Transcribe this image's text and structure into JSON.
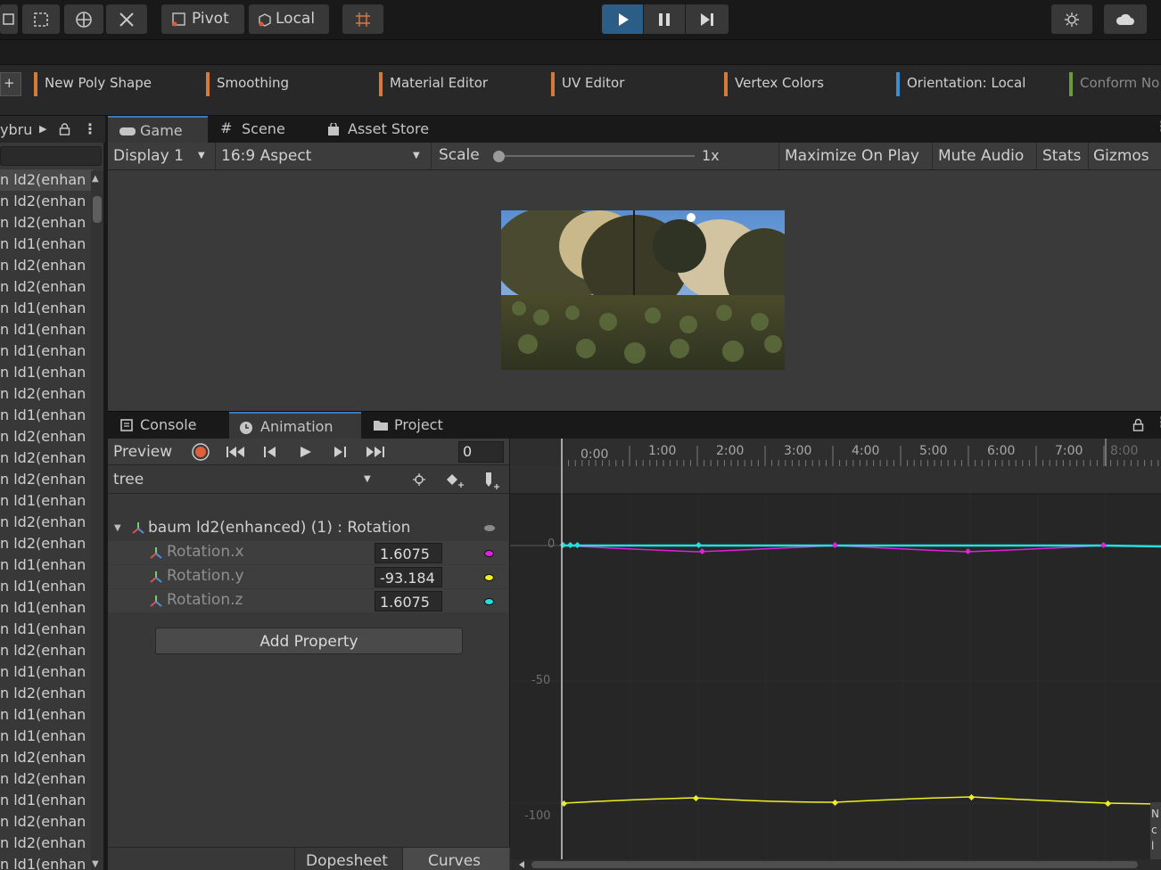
{
  "toolbar": {
    "pivot_label": "Pivot",
    "local_label": "Local"
  },
  "probuilder": {
    "add_label": "+",
    "items": [
      {
        "label": "New Poly Shape",
        "color": "#d47a3a"
      },
      {
        "label": "Smoothing",
        "color": "#d47a3a"
      },
      {
        "label": "Material Editor",
        "color": "#d47a3a"
      },
      {
        "label": "UV Editor",
        "color": "#d47a3a"
      },
      {
        "label": "Vertex Colors",
        "color": "#d47a3a"
      },
      {
        "label": "Orientation: Local",
        "color": "#3b8ed0"
      },
      {
        "label": "Conform No",
        "color": "#6a9a3a"
      }
    ]
  },
  "hierarchy": {
    "title": "ybru",
    "rows": [
      "n ld2(enhan",
      "n ld2(enhan",
      "n ld2(enhan",
      "n ld1(enhan",
      "n ld2(enhan",
      "n ld2(enhan",
      "n ld1(enhan",
      "n ld1(enhan",
      "n ld1(enhan",
      "n ld1(enhan",
      "n ld2(enhan",
      "n ld1(enhan",
      "n ld2(enhan",
      "n ld2(enhan",
      "n ld2(enhan",
      "n ld1(enhan",
      "n ld2(enhan",
      "n ld2(enhan",
      "n ld1(enhan",
      "n ld1(enhan",
      "n ld1(enhan",
      "n ld1(enhan",
      "n ld2(enhan",
      "n ld1(enhan",
      "n ld2(enhan",
      "n ld1(enhan",
      "n ld1(enhan",
      "n ld2(enhan",
      "n ld2(enhan",
      "n ld1(enhan",
      "n ld2(enhan",
      "n ld2(enhan",
      "n ld1(enhan"
    ]
  },
  "game": {
    "tabs": [
      "Game",
      "Scene",
      "Asset Store"
    ],
    "display": "Display 1",
    "aspect": "16:9 Aspect",
    "scale_label": "Scale",
    "scale_value": "1x",
    "maximize": "Maximize On Play",
    "mute": "Mute Audio",
    "stats": "Stats",
    "gizmos": "Gizmos"
  },
  "animation": {
    "tabs": [
      "Console",
      "Animation",
      "Project"
    ],
    "preview": "Preview",
    "frame": "0",
    "clip": "tree",
    "group": "baum ld2(enhanced) (1) : Rotation",
    "properties": [
      {
        "name": "Rotation.x",
        "value": "1.6075",
        "color": "#e020e0"
      },
      {
        "name": "Rotation.y",
        "value": "-93.184",
        "color": "#f0f020"
      },
      {
        "name": "Rotation.z",
        "value": "1.6075",
        "color": "#20e0e0"
      }
    ],
    "add_property": "Add Property",
    "bottom_tabs": [
      "Dopesheet",
      "Curves"
    ],
    "timeline": [
      "0:00",
      "1:00",
      "2:00",
      "3:00",
      "4:00",
      "5:00",
      "6:00",
      "7:00",
      "8:00"
    ],
    "y_labels": [
      "0",
      "-50",
      "-100"
    ],
    "corner_text": "N c l"
  }
}
